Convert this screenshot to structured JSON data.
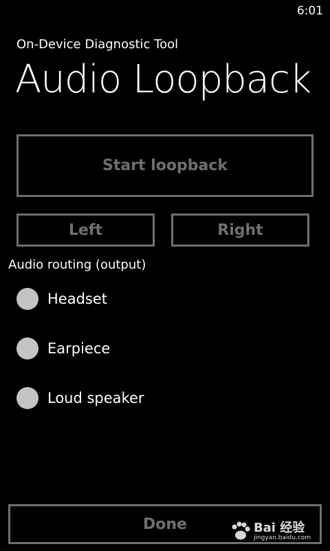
{
  "status_bar": {
    "time": "6:01"
  },
  "header": {
    "app_title": "On-Device Diagnostic Tool",
    "page_title": "Audio Loopback"
  },
  "controls": {
    "start_label": "Start loopback",
    "left_label": "Left",
    "right_label": "Right"
  },
  "routing": {
    "label": "Audio routing (output)",
    "options": [
      {
        "label": "Headset"
      },
      {
        "label": "Earpiece"
      },
      {
        "label": "Loud speaker"
      }
    ]
  },
  "footer": {
    "done_label": "Done"
  },
  "watermark": {
    "brand": "Bai 经验",
    "site": "jingyan.baidu.com"
  },
  "colors": {
    "background": "#000000",
    "text": "#ffffff",
    "disabled": "#6f6f6f",
    "radio_fill": "#c4c4c4"
  }
}
